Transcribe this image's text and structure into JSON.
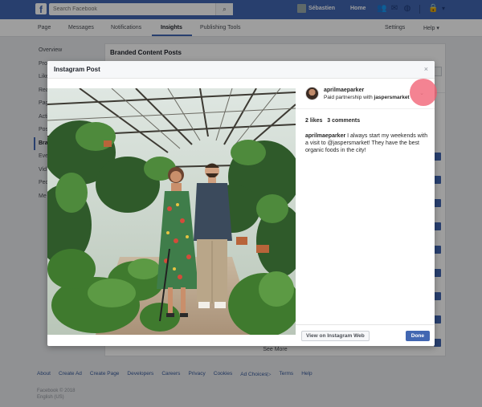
{
  "topbar": {
    "logo": "f",
    "search_placeholder": "Search Facebook",
    "user_name": "Sébastien",
    "home_label": "Home"
  },
  "pagenav": {
    "items": [
      "Page",
      "Messages",
      "Notifications",
      "Insights",
      "Publishing Tools"
    ],
    "active": "Insights",
    "settings": "Settings",
    "help": "Help ▾"
  },
  "leftmenu": {
    "items": [
      "Overview",
      "Pro",
      "Like",
      "Rea",
      "Pag",
      "Acti",
      "Pos",
      "Bra",
      "Eve",
      "Vid",
      "Peo",
      "Me"
    ]
  },
  "main": {
    "title": "Branded Content Posts",
    "see_more": "See More"
  },
  "footer": {
    "links": [
      "About",
      "Create Ad",
      "Create Page",
      "Developers",
      "Careers",
      "Privacy",
      "Cookies",
      "Ad Choices▷",
      "Terms",
      "Help"
    ],
    "copyright": "Facebook © 2018",
    "language": "English (US)"
  },
  "modal": {
    "title": "Instagram Post",
    "close": "×",
    "username": "aprilmaeparker",
    "partnership_prefix": "Paid partnership with ",
    "partner": "jaspersmarket",
    "chevron": "⌄",
    "likes": "2 likes",
    "comments": "3 comments",
    "caption_user": "aprilmaeparker",
    "caption_text": " I always start my weekends with a visit to @jaspersmarket! They have the best organic foods in the city!",
    "view_button": "View on Instagram Web",
    "done_button": "Done"
  },
  "colors": {
    "brand": "#4267b2",
    "overlay": "rgba(0,0,0,0.38)",
    "click_indicator": "#f05a6e"
  },
  "icons": [
    "facebook-logo-icon",
    "search-icon",
    "friends-icon",
    "messages-icon",
    "globe-icon",
    "lock-icon",
    "caret-down-icon",
    "close-icon",
    "chevron-down-icon"
  ]
}
